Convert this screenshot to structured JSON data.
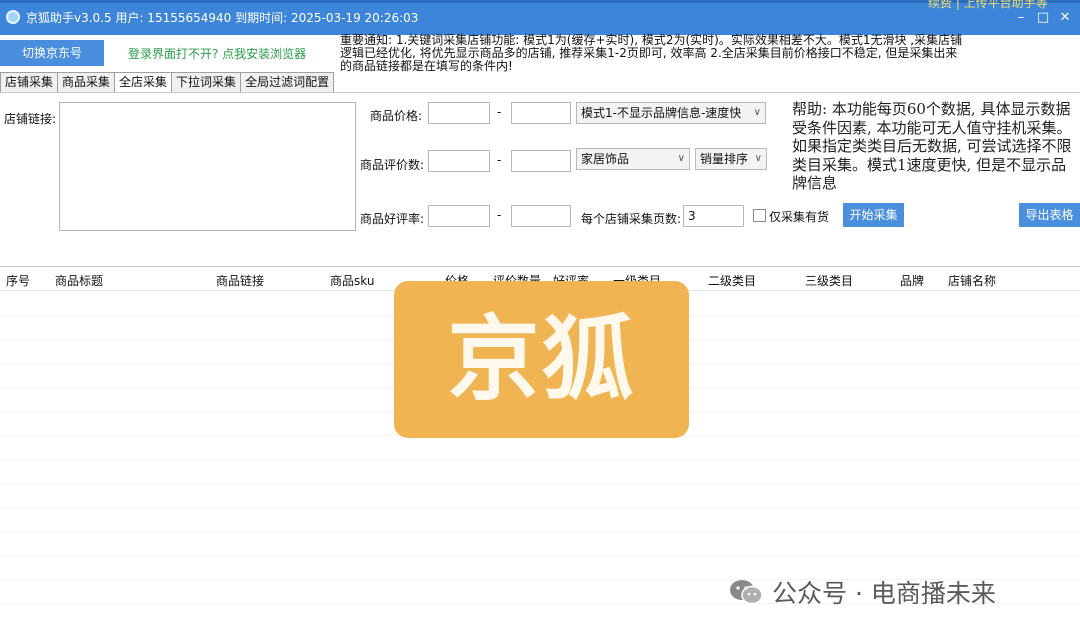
{
  "window": {
    "title": "京狐助手v3.0.5 用户: 15155654940 到期时间: 2025-03-19 20:26:03",
    "top_right_text": "续费 | 上传平台助手等",
    "controls": [
      "–",
      "□",
      "✕"
    ]
  },
  "header": {
    "switch_account": "切换京东号",
    "login_help": "登录界面打不开? 点我安装浏览器",
    "notice_lines": [
      "重要通知: 1.关键词采集店铺功能: 模式1为(缓存+实时), 模式2为(实时)。实际效果相差不大。模式1无滑块 ,采集店铺",
      "逻辑已经优化, 将优先显示商品多的店铺, 推荐采集1-2页即可, 效率高      2.全店采集目前价格接口不稳定, 但是采集出来",
      "的商品链接都是在填写的条件内!"
    ]
  },
  "tabs": [
    {
      "label": "店铺采集",
      "active": false
    },
    {
      "label": "商品采集",
      "active": false
    },
    {
      "label": "全店采集",
      "active": true
    },
    {
      "label": "下拉词采集",
      "active": false
    },
    {
      "label": "全局过滤词配置",
      "active": false
    }
  ],
  "form": {
    "store_link_label": "店铺链接:",
    "store_link_value": "",
    "price_label": "商品价格:",
    "review_count_label": "商品评价数:",
    "good_rate_label": "商品好评率:",
    "range_separator": "-",
    "mode_select": "模式1-不显示品牌信息-速度快",
    "category_select": "家居饰品",
    "sort_select": "销量排序",
    "pages_label": "每个店铺采集页数:",
    "pages_value": "3",
    "in_stock_label": "仅采集有货",
    "in_stock_checked": false,
    "start_button": "开始采集",
    "export_button": "导出表格"
  },
  "help_text": "帮助: 本功能每页60个数据, 具体显示数据受条件因素, 本功能可无人值守挂机采集。如果指定类类目后无数据, 可尝试选择不限类目采集。模式1速度更快, 但是不显示品牌信息",
  "table": {
    "columns": [
      "序号",
      "商品标题",
      "商品链接",
      "商品sku",
      "价格",
      "评价数量",
      "好评率",
      "一级类目",
      "二级类目",
      "三级类目",
      "品牌",
      "店铺名称"
    ]
  },
  "overlay_logo": "京狐",
  "watermark": "公众号 · 电商播未来",
  "colors": {
    "titlebar": "#3d85d8",
    "button": "#4a8fde",
    "logo_bg": "#f0b552",
    "link_green": "#2a9d4a"
  }
}
